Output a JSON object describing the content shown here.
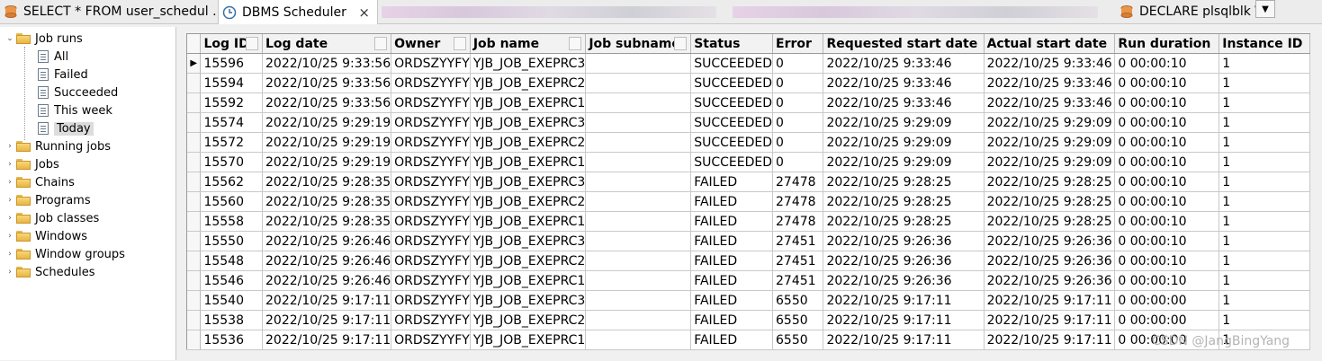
{
  "tabs": [
    {
      "label": "SELECT * FROM user_schedul …",
      "icon": "sql-script-icon"
    },
    {
      "label": "DBMS Scheduler",
      "icon": "scheduler-clock-icon",
      "active": true
    },
    {
      "label": "DECLARE plsqlblk \\"
    }
  ],
  "tree": {
    "root": "Job runs",
    "children": [
      "All",
      "Failed",
      "Succeeded",
      "This week",
      "Today"
    ],
    "selected": "Today",
    "folders": [
      "Running jobs",
      "Jobs",
      "Chains",
      "Programs",
      "Job classes",
      "Windows",
      "Window groups",
      "Schedules"
    ]
  },
  "columns": [
    "Log ID",
    "Log date",
    "Owner",
    "Job name",
    "Job subname",
    "Status",
    "Error",
    "Requested start date",
    "Actual start date",
    "Run duration",
    "Instance ID"
  ],
  "rows": [
    [
      "15596",
      "2022/10/25 9:33:56",
      "ORDSZYYFY",
      "YJB_JOB_EXEPRC3",
      "",
      "SUCCEEDED",
      "0",
      "2022/10/25 9:33:46",
      "2022/10/25 9:33:46",
      "0 00:00:10",
      "1"
    ],
    [
      "15594",
      "2022/10/25 9:33:56",
      "ORDSZYYFY",
      "YJB_JOB_EXEPRC2",
      "",
      "SUCCEEDED",
      "0",
      "2022/10/25 9:33:46",
      "2022/10/25 9:33:46",
      "0 00:00:10",
      "1"
    ],
    [
      "15592",
      "2022/10/25 9:33:56",
      "ORDSZYYFY",
      "YJB_JOB_EXEPRC1",
      "",
      "SUCCEEDED",
      "0",
      "2022/10/25 9:33:46",
      "2022/10/25 9:33:46",
      "0 00:00:10",
      "1"
    ],
    [
      "15574",
      "2022/10/25 9:29:19",
      "ORDSZYYFY",
      "YJB_JOB_EXEPRC3",
      "",
      "SUCCEEDED",
      "0",
      "2022/10/25 9:29:09",
      "2022/10/25 9:29:09",
      "0 00:00:10",
      "1"
    ],
    [
      "15572",
      "2022/10/25 9:29:19",
      "ORDSZYYFY",
      "YJB_JOB_EXEPRC2",
      "",
      "SUCCEEDED",
      "0",
      "2022/10/25 9:29:09",
      "2022/10/25 9:29:09",
      "0 00:00:10",
      "1"
    ],
    [
      "15570",
      "2022/10/25 9:29:19",
      "ORDSZYYFY",
      "YJB_JOB_EXEPRC1",
      "",
      "SUCCEEDED",
      "0",
      "2022/10/25 9:29:09",
      "2022/10/25 9:29:09",
      "0 00:00:10",
      "1"
    ],
    [
      "15562",
      "2022/10/25 9:28:35",
      "ORDSZYYFY",
      "YJB_JOB_EXEPRC3",
      "",
      "FAILED",
      "27478",
      "2022/10/25 9:28:25",
      "2022/10/25 9:28:25",
      "0 00:00:10",
      "1"
    ],
    [
      "15560",
      "2022/10/25 9:28:35",
      "ORDSZYYFY",
      "YJB_JOB_EXEPRC2",
      "",
      "FAILED",
      "27478",
      "2022/10/25 9:28:25",
      "2022/10/25 9:28:25",
      "0 00:00:10",
      "1"
    ],
    [
      "15558",
      "2022/10/25 9:28:35",
      "ORDSZYYFY",
      "YJB_JOB_EXEPRC1",
      "",
      "FAILED",
      "27478",
      "2022/10/25 9:28:25",
      "2022/10/25 9:28:25",
      "0 00:00:10",
      "1"
    ],
    [
      "15550",
      "2022/10/25 9:26:46",
      "ORDSZYYFY",
      "YJB_JOB_EXEPRC3",
      "",
      "FAILED",
      "27451",
      "2022/10/25 9:26:36",
      "2022/10/25 9:26:36",
      "0 00:00:10",
      "1"
    ],
    [
      "15548",
      "2022/10/25 9:26:46",
      "ORDSZYYFY",
      "YJB_JOB_EXEPRC2",
      "",
      "FAILED",
      "27451",
      "2022/10/25 9:26:36",
      "2022/10/25 9:26:36",
      "0 00:00:10",
      "1"
    ],
    [
      "15546",
      "2022/10/25 9:26:46",
      "ORDSZYYFY",
      "YJB_JOB_EXEPRC1",
      "",
      "FAILED",
      "27451",
      "2022/10/25 9:26:36",
      "2022/10/25 9:26:36",
      "0 00:00:10",
      "1"
    ],
    [
      "15540",
      "2022/10/25 9:17:11",
      "ORDSZYYFY",
      "YJB_JOB_EXEPRC3",
      "",
      "FAILED",
      "6550",
      "2022/10/25 9:17:11",
      "2022/10/25 9:17:11",
      "0 00:00:00",
      "1"
    ],
    [
      "15538",
      "2022/10/25 9:17:11",
      "ORDSZYYFY",
      "YJB_JOB_EXEPRC2",
      "",
      "FAILED",
      "6550",
      "2022/10/25 9:17:11",
      "2022/10/25 9:17:11",
      "0 00:00:00",
      "1"
    ],
    [
      "15536",
      "2022/10/25 9:17:11",
      "ORDSZYYFY",
      "YJB_JOB_EXEPRC1",
      "",
      "FAILED",
      "6550",
      "2022/10/25 9:17:11",
      "2022/10/25 9:17:11",
      "0 00:00:00",
      "1"
    ]
  ],
  "current_row_marker": "▶",
  "watermark": "CSDN @JangBingYang"
}
